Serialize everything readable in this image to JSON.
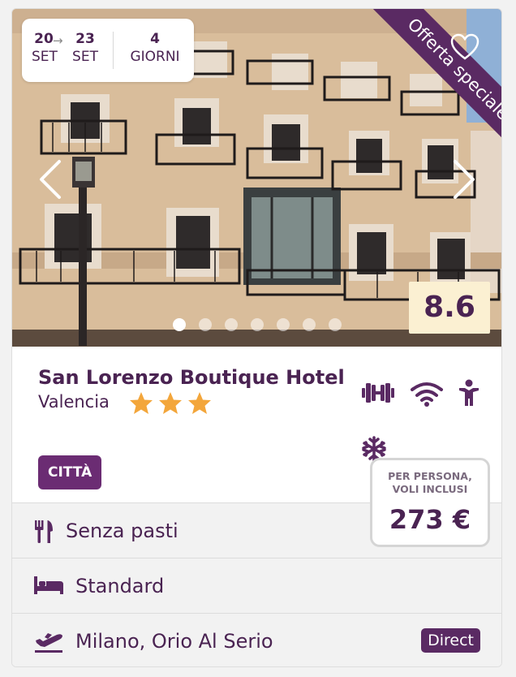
{
  "dates": {
    "from_day": "20",
    "from_month": "SET",
    "to_day": "23",
    "to_month": "SET",
    "duration_num": "4",
    "duration_unit": "GIORNI"
  },
  "ribbon": "Offerta speciale",
  "score": "8.6",
  "carousel": {
    "total": 7,
    "active": 0
  },
  "hotel": {
    "name": "San Lorenzo Boutique Hotel",
    "city": "Valencia",
    "stars": 3
  },
  "tag": "CITTÀ",
  "amenities": [
    "gym-icon",
    "wifi-icon",
    "kids-icon",
    "air-conditioning-icon"
  ],
  "price": {
    "label_line1": "PER PERSONA,",
    "label_line2": "VOLI INCLUSI",
    "value": "273 €"
  },
  "details": {
    "meals": "Senza pasti",
    "room": "Standard",
    "flight": "Milano, Orio Al Serio",
    "flight_badge": "Direct"
  },
  "colors": {
    "brand": "#4a2352",
    "ribbon": "#5a2a63",
    "star": "#f3a63b",
    "score_bg": "#fbf0d2"
  }
}
